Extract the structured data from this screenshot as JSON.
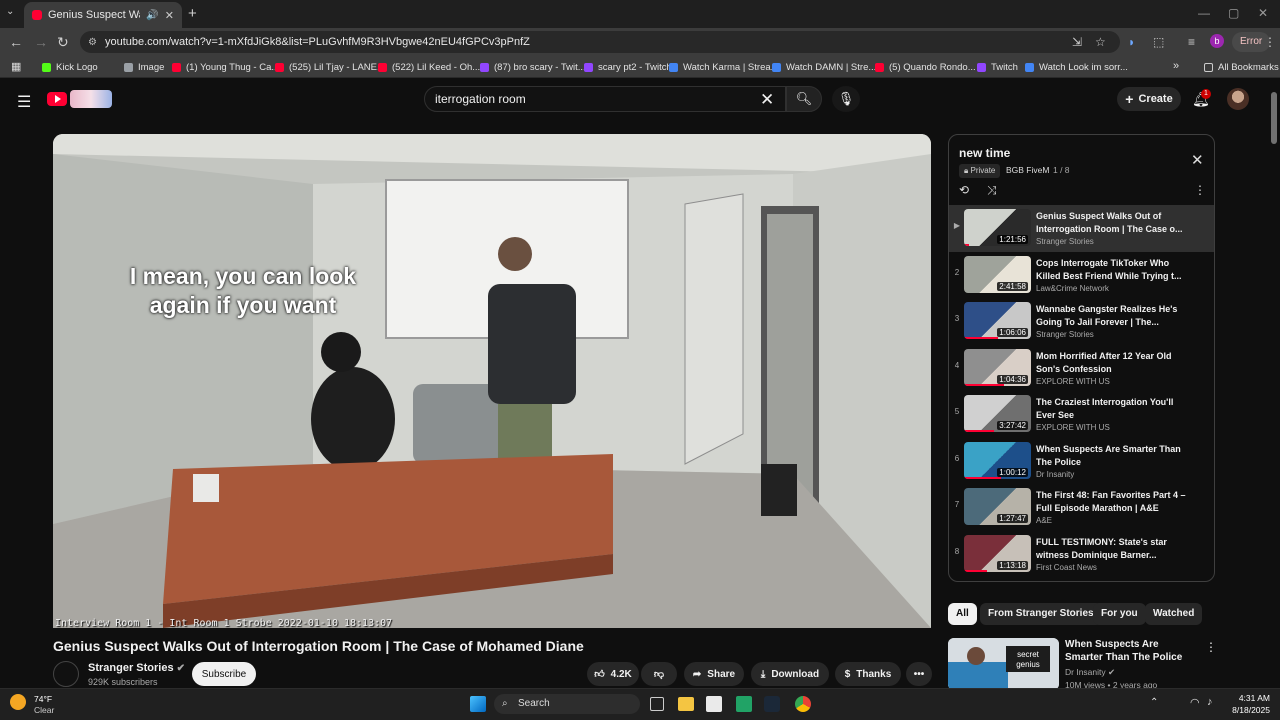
{
  "browser": {
    "tab_title": "Genius Suspect Walks Out of",
    "tab_audio": "🔊",
    "tab_close": "✕",
    "new_tab": "+",
    "tab_list": "⌄",
    "url": "youtube.com/watch?v=1-mXfdJiGk8&list=PLuGvhfM9R3HVbgwe42nEU4fGPCv3pPnfZ",
    "profile_letter": "b",
    "error_label": "Error",
    "bookmarks": [
      {
        "label": "Kick Logo",
        "color": "#53fc18"
      },
      {
        "label": "Image",
        "color": "#9aa0a6"
      },
      {
        "label": "(1) Young Thug - Ca...",
        "color": "#ff0033"
      },
      {
        "label": "(525) Lil Tjay - LANE...",
        "color": "#ff0033"
      },
      {
        "label": "(522) Lil Keed - Oh...",
        "color": "#ff0033"
      },
      {
        "label": "(87) bro scary - Twit...",
        "color": "#9146ff"
      },
      {
        "label": "scary pt2 - Twitch",
        "color": "#9146ff"
      },
      {
        "label": "Watch Karma | Strea...",
        "color": "#4285f4"
      },
      {
        "label": "Watch DAMN | Stre...",
        "color": "#4285f4"
      },
      {
        "label": "(5) Quando Rondo...",
        "color": "#ff0033"
      },
      {
        "label": "Twitch",
        "color": "#9146ff"
      },
      {
        "label": "Watch Look im sorr...",
        "color": "#4285f4"
      }
    ],
    "bookmarks_more": "»",
    "all_bookmarks": "All Bookmarks"
  },
  "header": {
    "search_value": "iterrogation room",
    "create_label": "Create",
    "notifications_count": "1"
  },
  "video": {
    "caption_line1": "I mean, you can look",
    "caption_line2": "again if you want",
    "overlay_text": "Interview Room 1 - Int Room 1 Strobe 2022-01-10 18:13:07",
    "title": "Genius Suspect Walks Out of Interrogation Room | The Case of Mohamed Diane",
    "channel": "Stranger Stories",
    "subscribers": "929K subscribers",
    "subscribe_label": "Subscribe",
    "likes": "4.2K",
    "share_label": "Share",
    "download_label": "Download",
    "thanks_label": "Thanks",
    "more": "•••"
  },
  "playlist": {
    "title": "new time",
    "privacy": "Private",
    "owner": "BGB FiveM",
    "position": "1 / 8",
    "items": [
      {
        "index": "▶",
        "title": "Genius Suspect Walks Out of Interrogation Room | The Case o...",
        "channel": "Stranger Stories",
        "duration": "1:21:56",
        "progress": 0.08,
        "thumb": [
          "#cfd2cc",
          "#2a2a2a"
        ]
      },
      {
        "index": "2",
        "title": "Cops Interrogate TikToker Who Killed Best Friend While Trying t...",
        "channel": "Law&Crime Network",
        "duration": "2:41:58",
        "progress": 0,
        "thumb": [
          "#9fa39b",
          "#e8e3d7"
        ]
      },
      {
        "index": "3",
        "title": "Wannabe Gangster Realizes He's Going To Jail Forever | The...",
        "channel": "Stranger Stories",
        "duration": "1:06:06",
        "progress": 0.5,
        "thumb": [
          "#2e4f88",
          "#c8c8c8"
        ]
      },
      {
        "index": "4",
        "title": "Mom Horrified After 12 Year Old Son's Confession",
        "channel": "EXPLORE WITH US",
        "duration": "1:04:36",
        "progress": 0.6,
        "thumb": [
          "#8f8f8f",
          "#d9cfc7"
        ]
      },
      {
        "index": "5",
        "title": "The Craziest Interrogation You'll Ever See",
        "channel": "EXPLORE WITH US",
        "duration": "3:27:42",
        "progress": 0.45,
        "thumb": [
          "#d0d0d0",
          "#6f6f6f"
        ]
      },
      {
        "index": "6",
        "title": "When Suspects Are Smarter Than The Police",
        "channel": "Dr Insanity",
        "duration": "1:00:12",
        "progress": 0.55,
        "thumb": [
          "#3aa2c6",
          "#1d4f8a"
        ]
      },
      {
        "index": "7",
        "title": "The First 48: Fan Favorites Part 4 – Full Episode Marathon | A&E",
        "channel": "A&E",
        "duration": "1:27:47",
        "progress": 0,
        "thumb": [
          "#4c6a7a",
          "#b6b2a8"
        ]
      },
      {
        "index": "8",
        "title": "FULL TESTIMONY: State's star witness Dominique Barner...",
        "channel": "First Coast News",
        "duration": "1:13:18",
        "progress": 0.35,
        "thumb": [
          "#7a2f3a",
          "#c7c0b8"
        ]
      }
    ]
  },
  "chips": [
    "All",
    "From Stranger Stories",
    "For you",
    "Watched"
  ],
  "related": {
    "title": "When Suspects Are Smarter Than The Police",
    "channel": "Dr Insanity",
    "views": "10M views • 2 years ago",
    "thumb_text": "secret genius"
  },
  "taskbar": {
    "temp": "74°F",
    "condition": "Clear",
    "search_label": "Search",
    "time": "4:31 AM",
    "date": "8/18/2025"
  },
  "colors": {
    "accent_red": "#ff0033",
    "background": "#0f0f0f"
  }
}
